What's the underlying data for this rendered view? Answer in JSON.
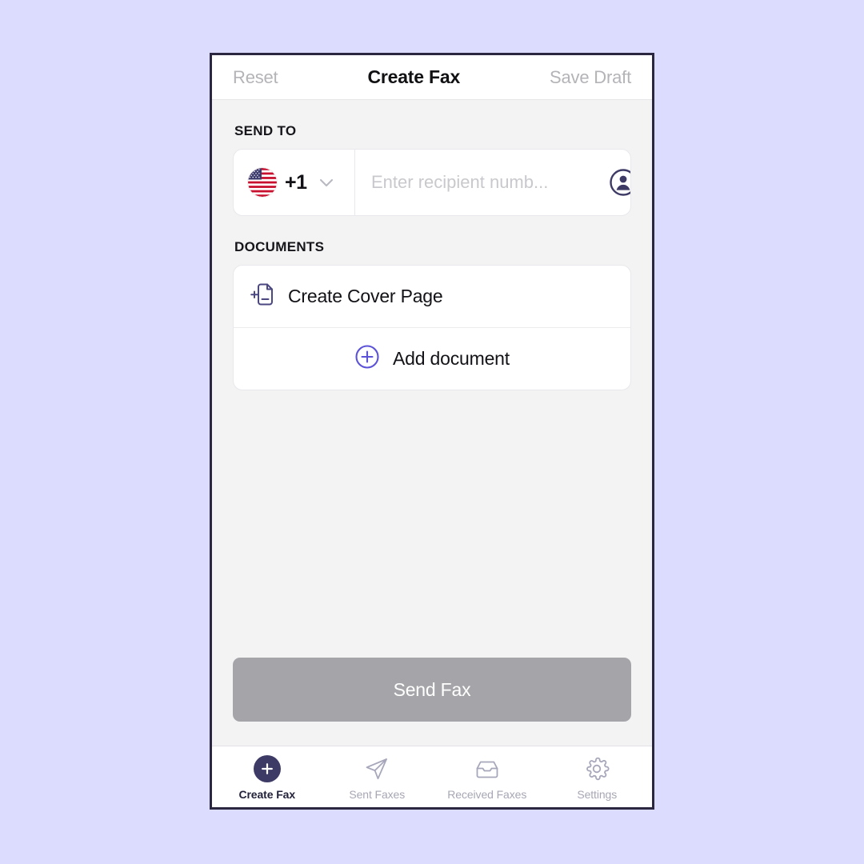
{
  "theme": {
    "page_background": "#dcdcfe",
    "frame_border": "#2b2740",
    "content_background": "#f3f3f4",
    "card_background": "#ffffff",
    "accent_indigo": "#5b52d8",
    "accent_navy": "#3d3a66",
    "muted_text": "#b4b4b8",
    "disabled_button": "#a5a5a9"
  },
  "header": {
    "reset_label": "Reset",
    "title": "Create Fax",
    "save_draft_label": "Save Draft"
  },
  "send_to": {
    "section_label": "SEND TO",
    "country": {
      "flag_icon": "us-flag-icon",
      "dial_code": "+1",
      "chevron_icon": "chevron-down-icon"
    },
    "recipient_input": {
      "placeholder": "Enter recipient numb...",
      "value": ""
    },
    "contacts_icon": "contact-person-icon"
  },
  "documents": {
    "section_label": "DOCUMENTS",
    "rows": [
      {
        "label": "Create Cover Page",
        "icon": "document-add-icon",
        "align": "left"
      },
      {
        "label": "Add document",
        "icon": "plus-circle-icon",
        "align": "center"
      }
    ]
  },
  "send_button": {
    "label": "Send Fax",
    "enabled": false
  },
  "tabbar": {
    "items": [
      {
        "label": "Create Fax",
        "icon": "plus-circle-filled-icon",
        "active": true
      },
      {
        "label": "Sent Faxes",
        "icon": "paper-plane-icon",
        "active": false
      },
      {
        "label": "Received Faxes",
        "icon": "inbox-tray-icon",
        "active": false
      },
      {
        "label": "Settings",
        "icon": "gear-icon",
        "active": false
      }
    ]
  }
}
